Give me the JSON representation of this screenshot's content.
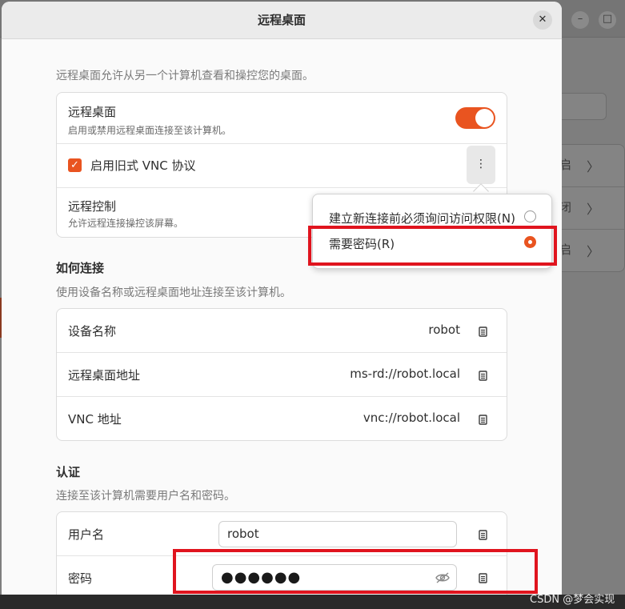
{
  "dialog": {
    "title": "远程桌面",
    "close_label": "✕"
  },
  "background_window": {
    "minimize_label": "–",
    "maximize_label": "□",
    "rows": [
      {
        "label": "启",
        "chevron": "〉"
      },
      {
        "label": "闭",
        "chevron": "〉"
      },
      {
        "label": "启",
        "chevron": "〉"
      }
    ]
  },
  "intro_desc": "远程桌面允许从另一个计算机查看和操控您的桌面。",
  "remote_card": {
    "remote_desktop": {
      "title": "远程桌面",
      "subtitle": "启用或禁用远程桌面连接至该计算机。",
      "toggle_on": true
    },
    "legacy_vnc": {
      "label": "启用旧式 VNC 协议",
      "checked": true,
      "menu_icon": "⋮"
    },
    "remote_control": {
      "title": "远程控制",
      "subtitle": "允许远程连接操控该屏幕。"
    }
  },
  "popover": {
    "items": [
      {
        "label": "建立新连接前必须询问访问权限(N)",
        "selected": false
      },
      {
        "label": "需要密码(R)",
        "selected": true
      }
    ]
  },
  "how_to_connect": {
    "title": "如何连接",
    "desc": "使用设备名称或远程桌面地址连接至该计算机。",
    "rows": [
      {
        "label": "设备名称",
        "value": "robot"
      },
      {
        "label": "远程桌面地址",
        "value": "ms-rd://robot.local"
      },
      {
        "label": "VNC 地址",
        "value": "vnc://robot.local"
      }
    ]
  },
  "auth": {
    "title": "认证",
    "desc": "连接至该计算机需要用户名和密码。",
    "username_label": "用户名",
    "username_value": "robot",
    "password_label": "密码",
    "password_masked": "●●●●●●"
  },
  "watermark": "CSDN @梦会实现",
  "colors": {
    "accent": "#e95420",
    "highlight": "#e0141e"
  }
}
